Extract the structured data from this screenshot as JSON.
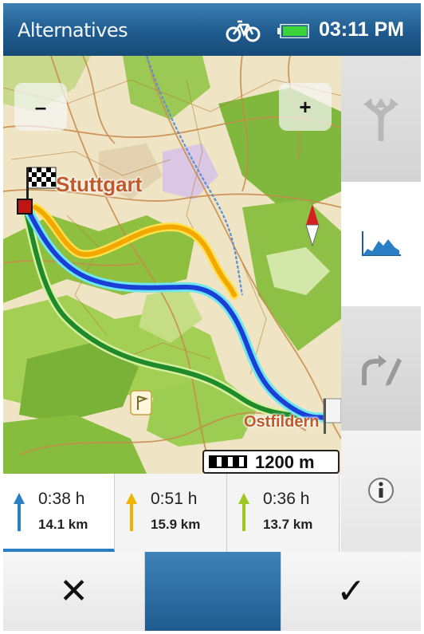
{
  "status_bar": {
    "title": "Alternatives",
    "time": "03:11 PM",
    "profile_icon": "bicycle-icon",
    "battery_icon": "battery-full-icon"
  },
  "map": {
    "zoom_out_label": "–",
    "zoom_in_label": "+",
    "labels": {
      "city_start": "Stuttgart",
      "city_end": "Ostfildern"
    },
    "scale_text": "1200 m",
    "route_colors": {
      "route_1": "#1a3fd6",
      "route_2": "#f2a800",
      "route_3": "#1e8a2a"
    }
  },
  "side_panel": {
    "buttons": [
      {
        "icon": "route-split-icon"
      },
      {
        "icon": "elevation-profile-icon"
      },
      {
        "icon": "edit-route-icon"
      },
      {
        "icon": "info-icon",
        "label": "i"
      }
    ]
  },
  "routes": [
    {
      "time": "0:38 h",
      "distance": "14.1 km",
      "color": "#2a7ec4",
      "selected": true
    },
    {
      "time": "0:51 h",
      "distance": "15.9 km",
      "color": "#f0b400",
      "selected": false
    },
    {
      "time": "0:36 h",
      "distance": "13.7 km",
      "color": "#9cc820",
      "selected": false
    }
  ],
  "bottom_bar": {
    "cancel_label": "✕",
    "confirm_label": "✓"
  }
}
